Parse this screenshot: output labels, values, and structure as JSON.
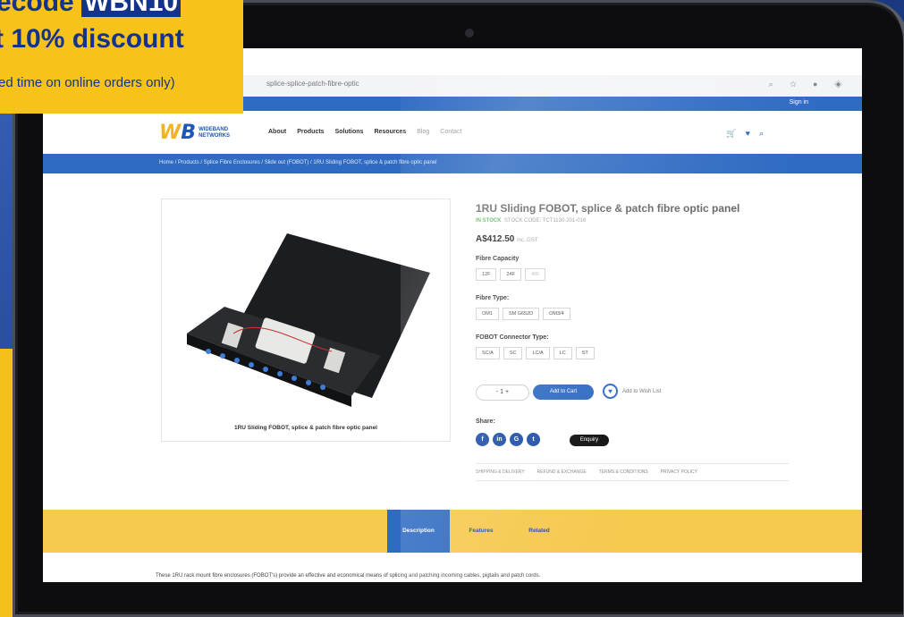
{
  "promo": {
    "line1_prefix": "ecode",
    "line1_code": "WBN10",
    "line2": "t 10% discount",
    "line3": "ed time on online orders only)"
  },
  "browser": {
    "address": "splice-splice-patch-fibre-optic",
    "icons": [
      "search-icon",
      "star-icon",
      "profile-icon",
      "shield-icon"
    ]
  },
  "site": {
    "signin": "Sign in",
    "logo_mark": "WB",
    "logo_text": "WIDEBAND NETWORKS",
    "nav": [
      "About",
      "Products",
      "Solutions",
      "Resources",
      "Blog",
      "Contact"
    ],
    "breadcrumb": "Home  /  Products  /  Splice Fibre Enclosures  /  Slide out (FOBOT)  /  1RU Sliding FOBOT, splice & patch fibre optic panel"
  },
  "product": {
    "image_caption": "1RU Sliding FOBOT, splice & patch fibre optic panel",
    "title": "1RU Sliding FOBOT, splice & patch fibre optic panel",
    "stock": "IN STOCK",
    "stock_code": "STOCK CODE: TCT1130-201-016",
    "price": "A$412.50",
    "price_note": "inc. GST",
    "fibre_capacity_label": "Fibre Capacity",
    "fibre_capacity_options": [
      "12F",
      "24F",
      "48F"
    ],
    "fibre_type_label": "Fibre Type:",
    "fibre_type_options": [
      "OM1",
      "SM G652D",
      "OM3/4"
    ],
    "connector_label": "FOBOT Connector Type:",
    "connector_options": [
      "SC/A",
      "SC",
      "LC/A",
      "LC",
      "ST"
    ],
    "qty": "-   1   +",
    "add_to_cart": "Add to Cart",
    "wishlist": "Add to Wish List",
    "share_label": "Share:",
    "social": [
      "f",
      "in",
      "G",
      "t"
    ],
    "enquiry": "Enquiry",
    "info_tabs": [
      "SHIPPING & DELIVERY",
      "REFUND & EXCHANGE",
      "TERMS & CONDITIONS",
      "PRIVACY POLICY"
    ]
  },
  "band_tabs": [
    "Description",
    "Features",
    "Related"
  ],
  "description": "These 1RU rack mount fibre enclosures (FOBOT's) provide an effective and economical means of splicing and patching incoming cables, pigtails and patch cords."
}
